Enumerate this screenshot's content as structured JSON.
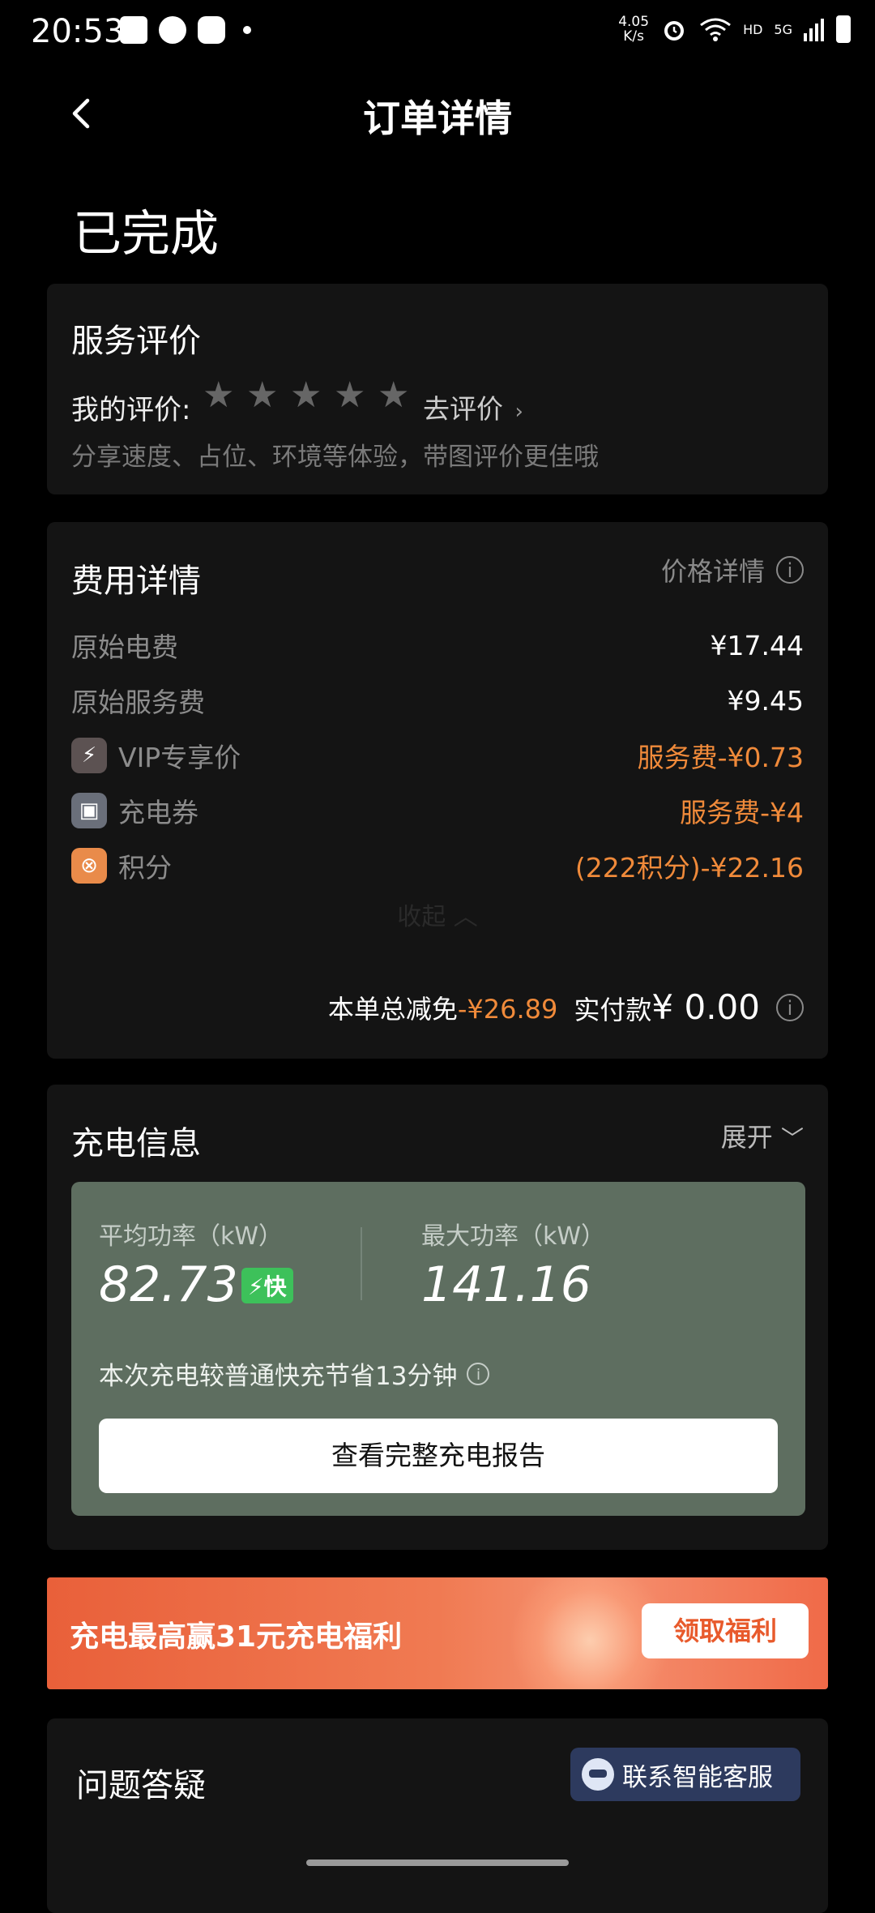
{
  "status_bar": {
    "time": "20:53",
    "net_speed": "4.05\nK/s",
    "net_speed_top": "4.05",
    "net_speed_bottom": "K/s",
    "hd": "HD",
    "signal": "5G"
  },
  "nav": {
    "title": "订单详情"
  },
  "order": {
    "status": "已完成"
  },
  "review": {
    "title": "服务评价",
    "my_rating_label": "我的评价:",
    "stars_filled": 0,
    "stars_total": 5,
    "go_review": "去评价",
    "hint": "分享速度、占位、环境等体验，带图评价更佳哦"
  },
  "fee": {
    "title": "费用详情",
    "price_detail": "价格详情",
    "rows": [
      {
        "label": "原始电费",
        "value": "¥17.44"
      },
      {
        "label": "原始服务费",
        "value": "¥9.45"
      },
      {
        "label": "VIP专享价",
        "value": "服务费-¥0.73"
      },
      {
        "label": "充电券",
        "value": "服务费-¥4"
      },
      {
        "label": "积分",
        "value": "(222积分)-¥22.16"
      }
    ],
    "collapse": "收起",
    "total_discount_label": "本单总减免",
    "total_discount_value": "-¥26.89",
    "paid_label": "实付款",
    "paid_value": "¥ 0.00"
  },
  "charge": {
    "title": "充电信息",
    "expand": "展开",
    "avg_power_label": "平均功率（kW）",
    "avg_power_value": "82.73",
    "fast_badge": "快",
    "max_power_label": "最大功率（kW）",
    "max_power_value": "141.16",
    "saving_text": "本次充电较普通快充节省13分钟",
    "report_button": "查看完整充电报告"
  },
  "banner": {
    "text": "充电最高赢31元充电福利",
    "button": "领取福利"
  },
  "faq": {
    "title": "问题答疑",
    "cs_button": "联系智能客服"
  },
  "colors": {
    "accent_orange": "#f08a3a",
    "fast_green": "#3dc15a",
    "panel_green": "#5e6e60"
  }
}
